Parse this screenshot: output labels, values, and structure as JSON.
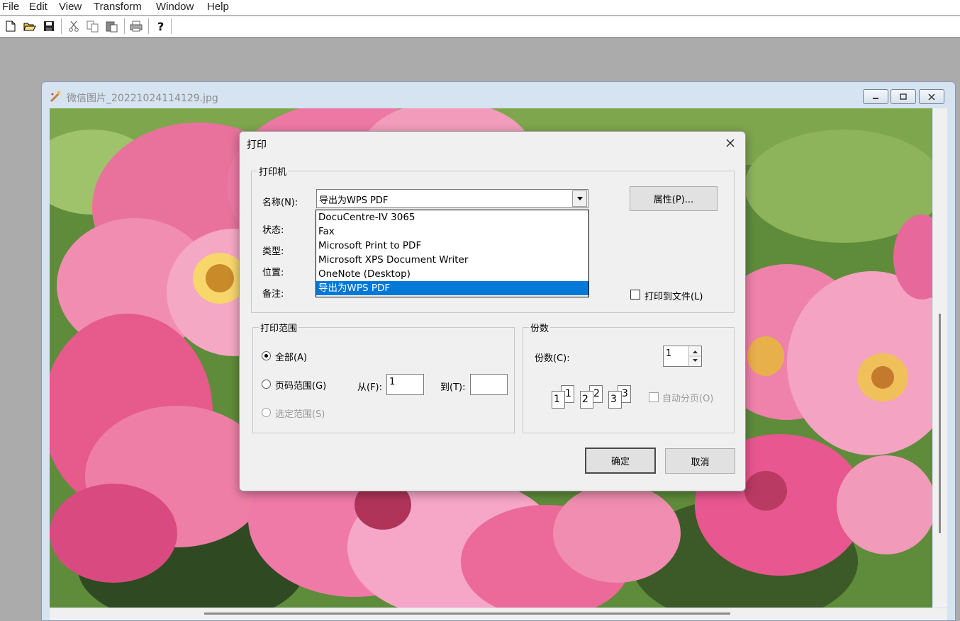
{
  "menu": [
    "File",
    "Edit",
    "View",
    "Transform",
    "Window",
    "Help"
  ],
  "toolbar": {
    "icons": [
      "new-icon",
      "open-icon",
      "save-icon",
      "cut-icon",
      "copy-icon",
      "paste-icon",
      "print-icon",
      "help-icon"
    ]
  },
  "document_window": {
    "title": "微信图片_20221024114129.jpg",
    "buttons": [
      "minimize",
      "maximize",
      "close"
    ]
  },
  "print_dialog": {
    "title": "打印",
    "printer_group": {
      "legend": "打印机",
      "name_label": "名称(N):",
      "selected_printer": "导出为WPS PDF",
      "printer_options": [
        "DocuCentre-IV 3065",
        "Fax",
        "Microsoft Print to PDF",
        "Microsoft XPS Document Writer",
        "OneNote (Desktop)",
        "导出为WPS PDF"
      ],
      "status_label": "状态:",
      "type_label": "类型:",
      "location_label": "位置:",
      "comment_label": "备注:",
      "properties_button": "属性(P)...",
      "print_to_file_label": "打印到文件(L)",
      "print_to_file_checked": false
    },
    "range_group": {
      "legend": "打印范围",
      "all_label": "全部(A)",
      "pages_label": "页码范围(G)",
      "from_label": "从(F):",
      "from_value": "1",
      "to_label": "到(T):",
      "to_value": "",
      "selection_label": "选定范围(S)",
      "selected_option": "all"
    },
    "copies_group": {
      "legend": "份数",
      "copies_label": "份数(C):",
      "copies_value": "1",
      "collate_label": "自动分页(O)",
      "collate_checked": false,
      "collate_page_numbers": [
        "1",
        "1",
        "2",
        "2",
        "3",
        "3"
      ]
    },
    "ok_button": "确定",
    "cancel_button": "取消"
  }
}
